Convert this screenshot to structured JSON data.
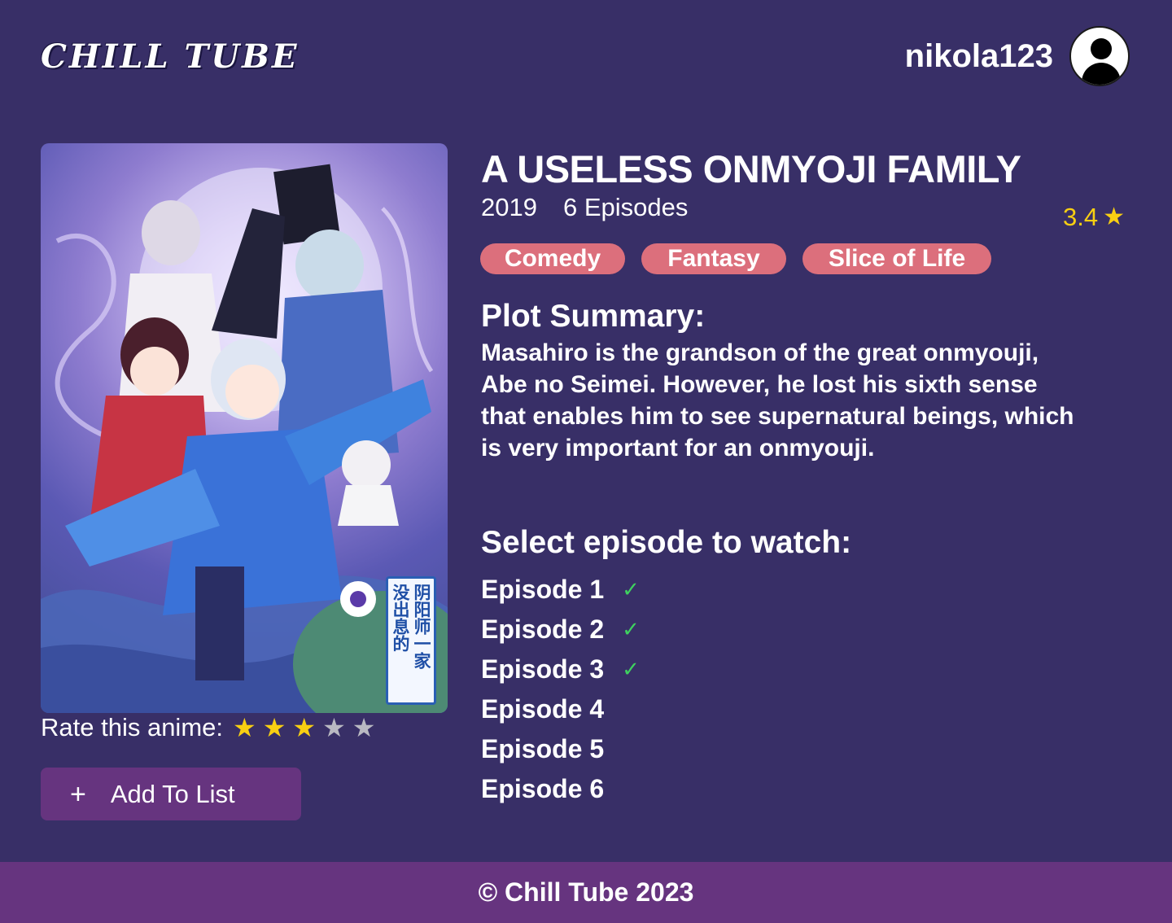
{
  "header": {
    "logo": "CHILL TUBE",
    "username": "nikola123",
    "avatar_icon": "user-avatar-icon"
  },
  "poster": {
    "title_lines": [
      "阴阳师一家",
      "没出息的"
    ]
  },
  "rating": {
    "label": "Rate this anime:",
    "user_stars": 3,
    "max_stars": 5,
    "star_char": "★"
  },
  "actions": {
    "add_plus": "+",
    "add_label": "Add To List"
  },
  "anime": {
    "title": "A USELESS ONMYOJI FAMILY",
    "year": "2019",
    "episodes_count": "6 Episodes",
    "score": "3.4",
    "genres": [
      "Comedy",
      "Fantasy",
      "Slice of Life"
    ]
  },
  "plot": {
    "heading": "Plot Summary:",
    "text": "Masahiro is the grandson of the great onmyouji, Abe no Seimei. However, he lost his sixth sense that enables him to see supernatural beings, which is very important for an onmyouji."
  },
  "episode_section": {
    "heading": "Select episode to watch:",
    "check_char": "✓",
    "episodes": [
      {
        "label": "Episode 1",
        "watched": true
      },
      {
        "label": "Episode 2",
        "watched": true
      },
      {
        "label": "Episode 3",
        "watched": true
      },
      {
        "label": "Episode 4",
        "watched": false
      },
      {
        "label": "Episode 5",
        "watched": false
      },
      {
        "label": "Episode 6",
        "watched": false
      }
    ]
  },
  "footer": {
    "text": "© Chill Tube 2023"
  },
  "colors": {
    "background": "#382f67",
    "accent_purple": "#66347f",
    "genre_pill": "#dc6f7c",
    "star_gold": "#f8cf12",
    "star_gray": "#b9b9c2",
    "check_green": "#3fd15f"
  }
}
